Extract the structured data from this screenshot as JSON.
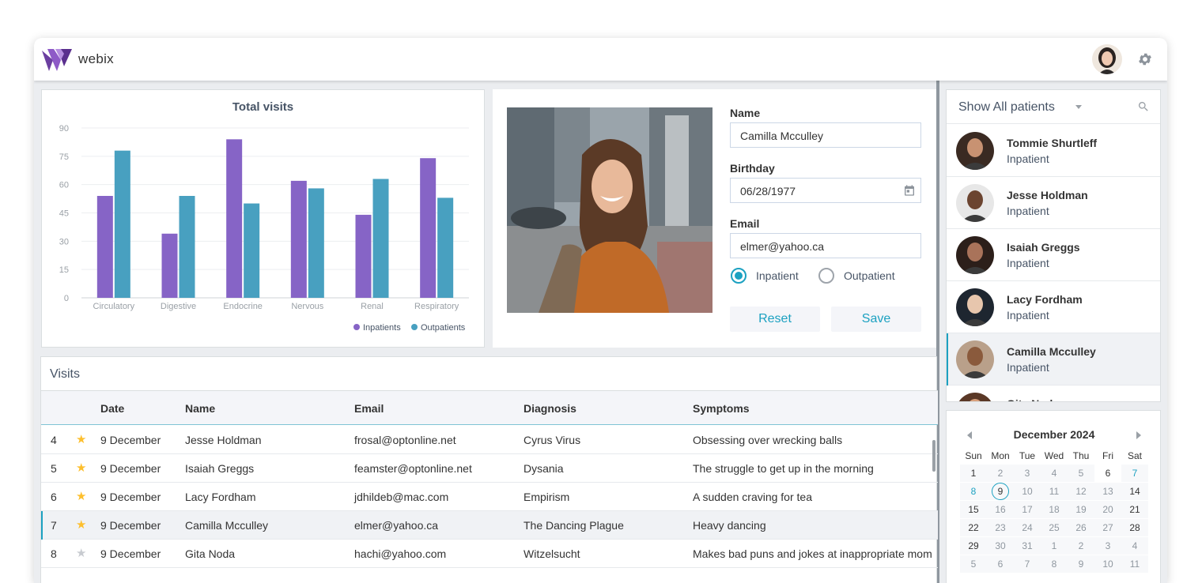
{
  "app": {
    "brand": "webix"
  },
  "chart": {
    "title": "Total visits",
    "legend": [
      "Inpatients",
      "Outpatients"
    ]
  },
  "chart_data": {
    "type": "bar",
    "title": "Total visits",
    "categories": [
      "Circulatory",
      "Digestive",
      "Endocrine",
      "Nervous",
      "Renal",
      "Respiratory"
    ],
    "series": [
      {
        "name": "Inpatients",
        "values": [
          54,
          34,
          84,
          62,
          44,
          74
        ],
        "color": "#8664c6"
      },
      {
        "name": "Outpatients",
        "values": [
          78,
          54,
          50,
          58,
          63,
          53
        ],
        "color": "#48a0c0"
      }
    ],
    "yticks": [
      0,
      15,
      30,
      45,
      60,
      75,
      90
    ],
    "ylim": [
      0,
      90
    ],
    "legend_position": "bottom-right",
    "grid": true
  },
  "form": {
    "name_label": "Name",
    "name_value": "Camilla Mcculley",
    "birthday_label": "Birthday",
    "birthday_value": "06/28/1977",
    "email_label": "Email",
    "email_value": "elmer@yahoo.ca",
    "radio_inpatient": "Inpatient",
    "radio_outpatient": "Outpatient",
    "reset_label": "Reset",
    "save_label": "Save"
  },
  "visits": {
    "title": "Visits",
    "columns": [
      "Date",
      "Name",
      "Email",
      "Diagnosis",
      "Symptoms"
    ],
    "rows": [
      {
        "id": "4",
        "starred": true,
        "date": "9 December",
        "name": "Jesse Holdman",
        "email": "frosal@optonline.net",
        "diagnosis": "Cyrus Virus",
        "symptoms": "Obsessing over wrecking balls"
      },
      {
        "id": "5",
        "starred": true,
        "date": "9 December",
        "name": "Isaiah Greggs",
        "email": "feamster@optonline.net",
        "diagnosis": "Dysania",
        "symptoms": "The struggle to get up in the morning"
      },
      {
        "id": "6",
        "starred": true,
        "date": "9 December",
        "name": "Lacy Fordham",
        "email": "jdhildeb@mac.com",
        "diagnosis": "Empirism",
        "symptoms": "A sudden craving for tea"
      },
      {
        "id": "7",
        "starred": true,
        "date": "9 December",
        "name": "Camilla Mcculley",
        "email": "elmer@yahoo.ca",
        "diagnosis": "The Dancing Plague",
        "symptoms": "Heavy dancing"
      },
      {
        "id": "8",
        "starred": false,
        "date": "9 December",
        "name": "Gita Noda",
        "email": "hachi@yahoo.com",
        "diagnosis": "Witzelsucht",
        "symptoms": "Makes bad puns and jokes at inappropriate mom"
      }
    ]
  },
  "patients": {
    "title": "Show All patients",
    "items": [
      {
        "name": "Tommie Shurtleff",
        "type": "Inpatient"
      },
      {
        "name": "Jesse Holdman",
        "type": "Inpatient"
      },
      {
        "name": "Isaiah Greggs",
        "type": "Inpatient"
      },
      {
        "name": "Lacy Fordham",
        "type": "Inpatient"
      },
      {
        "name": "Camilla Mcculley",
        "type": "Inpatient"
      },
      {
        "name": "Gita Noda",
        "type": ""
      }
    ]
  },
  "calendar": {
    "month": "December 2024",
    "weekdays": [
      "Sun",
      "Mon",
      "Tue",
      "Wed",
      "Thu",
      "Fri",
      "Sat"
    ],
    "weeks": [
      [
        "1",
        "2",
        "3",
        "4",
        "5",
        "6",
        "7"
      ],
      [
        "8",
        "9",
        "10",
        "11",
        "12",
        "13",
        "14"
      ],
      [
        "15",
        "16",
        "17",
        "18",
        "19",
        "20",
        "21"
      ],
      [
        "22",
        "23",
        "24",
        "25",
        "26",
        "27",
        "28"
      ],
      [
        "29",
        "30",
        "31",
        "1",
        "2",
        "3",
        "4"
      ],
      [
        "5",
        "6",
        "7",
        "8",
        "9",
        "10",
        "11"
      ]
    ],
    "today": "9"
  },
  "colors": {
    "accent": "#1ca1c1",
    "inpatients": "#8664c6",
    "outpatients": "#48a0c0",
    "star_on": "#fdbf2d",
    "star_off": "#c8cbd0"
  }
}
